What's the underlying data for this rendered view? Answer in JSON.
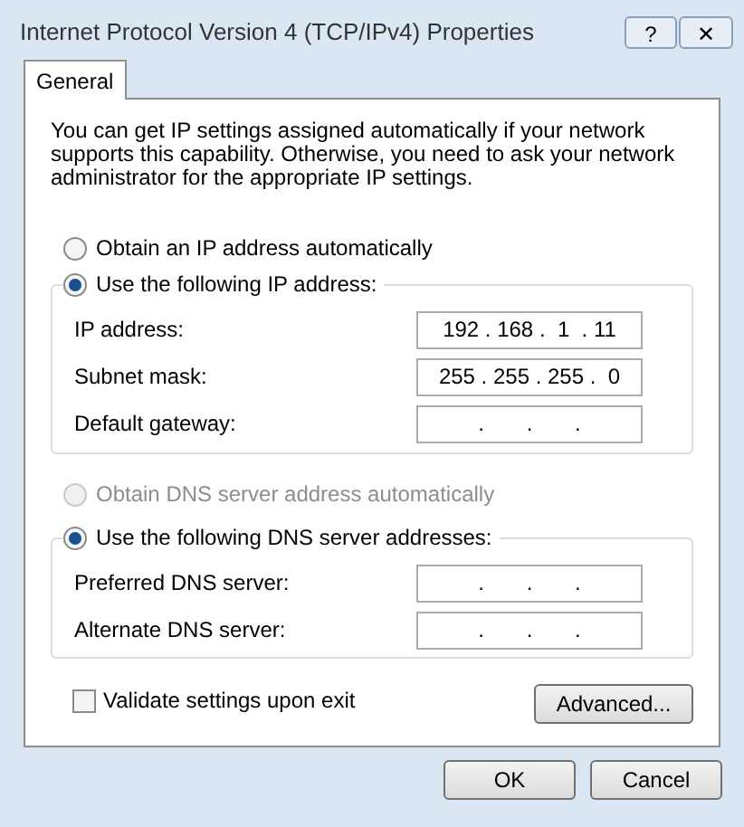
{
  "window": {
    "title": "Internet Protocol Version 4 (TCP/IPv4) Properties",
    "help_button": "?",
    "close_button": "✕"
  },
  "tabs": [
    {
      "label": "General",
      "selected": true
    }
  ],
  "description": "You can get IP settings assigned automatically if your network supports this capability. Otherwise, you need to ask your network administrator for the appropriate IP settings.",
  "ip_mode": [
    {
      "label": "Obtain an IP address automatically",
      "selected": false,
      "disabled": false
    },
    {
      "label": "Use the following IP address:",
      "selected": true,
      "disabled": false
    }
  ],
  "ip_fields": [
    {
      "label": "IP address:",
      "value": "192 . 168 .  1  . 11"
    },
    {
      "label": "Subnet mask:",
      "value": "255 . 255 . 255 .  0"
    },
    {
      "label": "Default gateway:",
      "value": ".       .       ."
    }
  ],
  "dns_mode": [
    {
      "label": "Obtain DNS server address automatically",
      "selected": false,
      "disabled": true
    },
    {
      "label": "Use the following DNS server addresses:",
      "selected": true,
      "disabled": false
    }
  ],
  "dns_fields": [
    {
      "label": "Preferred DNS server:",
      "value": ".       .       ."
    },
    {
      "label": "Alternate DNS server:",
      "value": ".       .       ."
    }
  ],
  "validate": {
    "label": "Validate settings upon exit",
    "checked": false
  },
  "advanced_button": "Advanced...",
  "buttons": [
    "OK",
    "Cancel"
  ]
}
